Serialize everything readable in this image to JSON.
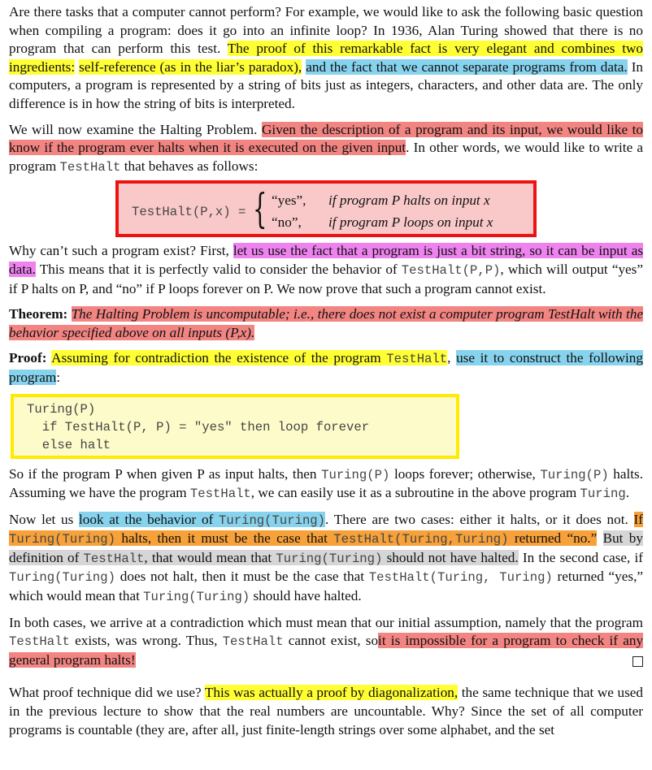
{
  "para1": {
    "t1": "Are there tasks that a computer cannot perform? For example, we would like to ask the following basic question when compiling a program: does it go into an infinite loop? In 1936, Alan Turing showed that there is no program that can perform this test.",
    "h1": "The proof of this remarkable fact is very elegant and combines two ingredients:",
    "h2": "self-reference (as in the liar’s paradox),",
    "h3": "and the fact that we cannot separate programs from data.",
    "t2": "In computers, a program is represented by a string of bits just as integers, characters, and other data are. The only difference is in how the string of bits is interpreted."
  },
  "para2": {
    "t1": "We will now examine the Halting Problem.",
    "h1": "Given the description of a program and its input, we would like to know if the program ever halts when it is executed on the given input",
    "t2": ". In other words, we would like to write a program",
    "code": "TestHalt",
    "t3": "that behaves as follows:"
  },
  "formula": {
    "lhs": "TestHalt(P,x) =",
    "case1": "“yes”,",
    "cond1": "if program P halts on input x",
    "case2": "“no”,",
    "cond2": "if program P loops on input x"
  },
  "para3": {
    "t1": "Why can’t such a program exist? First,",
    "h1": "let us use the fact that a program is just a bit string, so it can be input as data.",
    "t2": "This means that it is perfectly valid to consider the behavior of",
    "code": "TestHalt(P,P)",
    "t3": ", which will output “yes” if P halts on P, and “no” if P loops forever on P. We now prove that such a program cannot exist."
  },
  "theorem": {
    "label": "Theorem:",
    "text": "The Halting Problem is uncomputable; i.e., there does not exist a computer program TestHalt with the behavior specified above on all inputs (P,x)."
  },
  "proof": {
    "label": "Proof:",
    "h1a": "Assuming for contradiction the existence of the program",
    "code": "TestHalt",
    "h2": "use it to construct the following program",
    "t1": ":"
  },
  "code_block": {
    "line1": "Turing(P)",
    "line2": "  if TestHalt(P, P) = \"yes\" then loop forever",
    "line3": "  else halt"
  },
  "para4": {
    "t1": "So if the program P when given P as input halts, then",
    "c1": "Turing(P)",
    "t2": "loops forever; otherwise,",
    "c2": "Turing(P)",
    "t3": "halts. Assuming we have the program",
    "c3": "TestHalt",
    "t4": ", we can easily use it as a subroutine in the above program",
    "c4": "Turing",
    "t5": "."
  },
  "para5": {
    "t1": "Now let us",
    "h1": "look at the behavior of",
    "c1": "Turing(Turing)",
    "t2": ". There are two cases: either it halts, or it does not.",
    "o1": "If",
    "oc1": "Turing(Turing)",
    "o2": "halts, then it must be the case that",
    "oc2": "TestHalt(Turing,Turing)",
    "o3": "returned “no.”",
    "g1": "But by definition of",
    "gc1": "TestHalt",
    "g2": ", that would mean that",
    "gc2": "Turing(Turing)",
    "g3": "should not have halted.",
    "t3": "In the second case, if",
    "c2": "Turing(Turing)",
    "t4": "does not halt, then it must be the case that",
    "c3": "TestHalt(Turing, Turing)",
    "t5": "returned “yes,” which would mean that",
    "c4": "Turing(Turing)",
    "t6": "should have halted."
  },
  "para6": {
    "t1": "In both cases, we arrive at a contradiction which must mean that our initial assumption, namely that the program",
    "c1": "TestHalt",
    "t2": "exists, was wrong. Thus,",
    "c2": "TestHalt",
    "t3": "cannot exist, so",
    "h1": "it is impossible for a program to check if any general program halts!"
  },
  "para7": {
    "t1": "What proof technique did we use?",
    "h1": "This was actually a proof by diagonalization,",
    "t2": "the same technique that we used in the previous lecture to show that the real numbers are uncountable. Why? Since the set of all computer programs is countable (they are, after all, just finite-length strings over some alphabet, and the set"
  }
}
